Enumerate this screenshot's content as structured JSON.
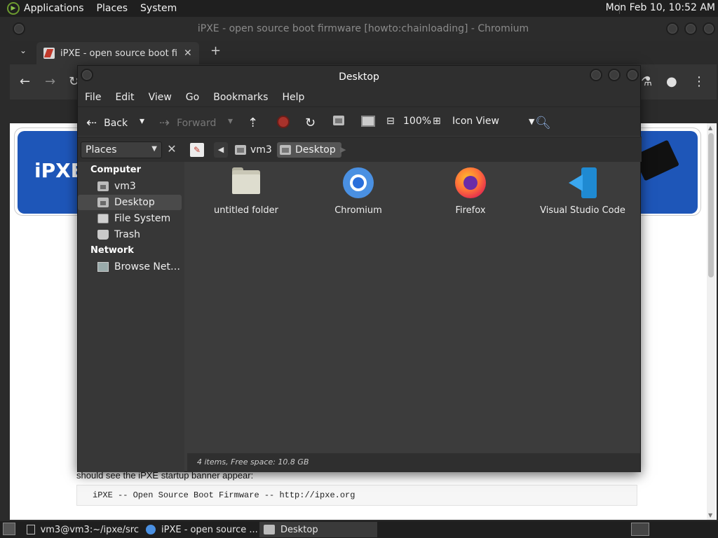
{
  "top_panel": {
    "menus": [
      "Applications",
      "Places",
      "System"
    ],
    "clock": "Mon Feb 10, 10:52 AM"
  },
  "chromium": {
    "window_title": "iPXE - open source boot firmware [howto:chainloading] - Chromium",
    "tab_title": "iPXE - open source boot firmware",
    "tab_close": "✕",
    "new_tab": "+",
    "page": {
      "logo_text": "iPXE",
      "text_line": "should see the iPXE startup banner appear:",
      "code_line": "iPXE -- Open Source Boot Firmware -- http://ipxe.org"
    }
  },
  "file_manager": {
    "window_title": "Desktop",
    "menu": [
      "File",
      "Edit",
      "View",
      "Go",
      "Bookmarks",
      "Help"
    ],
    "toolbar": {
      "back": "Back",
      "forward": "Forward",
      "zoom": "100%",
      "view_mode": "Icon View"
    },
    "sidebar_combo": "Places",
    "path": [
      "vm3",
      "Desktop"
    ],
    "sidebar": {
      "computer_heading": "Computer",
      "computer_items": [
        "vm3",
        "Desktop",
        "File System",
        "Trash"
      ],
      "network_heading": "Network",
      "network_items": [
        "Browse Net…"
      ]
    },
    "files": [
      "untitled folder",
      "Chromium",
      "Firefox",
      "Visual Studio Code"
    ],
    "status": "4 items, Free space: 10.8 GB"
  },
  "taskbar": {
    "tasks": [
      "vm3@vm3:~/ipxe/src",
      "iPXE - open source ...",
      "Desktop"
    ]
  },
  "colors": {
    "panel": "#1f1f1f",
    "fm_background": "#3c3c3c",
    "ipxe_blue": "#1e56b8"
  }
}
